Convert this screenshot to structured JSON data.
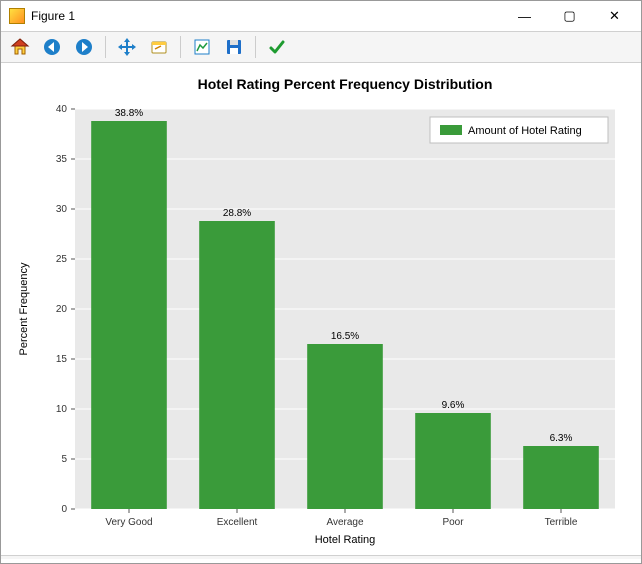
{
  "window": {
    "title": "Figure 1",
    "buttons": {
      "min": "—",
      "max": "▢",
      "close": "✕"
    }
  },
  "toolbar": {
    "icons": {
      "home": "home-icon",
      "back": "arrow-left-icon",
      "forward": "arrow-right-icon",
      "pan": "move-icon",
      "zoom": "zoom-icon",
      "subplots": "subplots-icon",
      "save": "save-icon",
      "edit": "check-icon"
    }
  },
  "chart_data": {
    "type": "bar",
    "title": "Hotel Rating Percent Frequency Distribution",
    "xlabel": "Hotel Rating",
    "ylabel": "Percent Frequency",
    "ylim": [
      0,
      40
    ],
    "yticks": [
      0,
      5,
      10,
      15,
      20,
      25,
      30,
      35,
      40
    ],
    "categories": [
      "Very Good",
      "Excellent",
      "Average",
      "Poor",
      "Terrible"
    ],
    "values": [
      38.8,
      28.8,
      16.5,
      9.6,
      6.3
    ],
    "value_labels": [
      "38.8%",
      "28.8%",
      "16.5%",
      "9.6%",
      "6.3%"
    ],
    "legend": "Amount of Hotel Rating",
    "bar_color": "#3a9b3a"
  }
}
